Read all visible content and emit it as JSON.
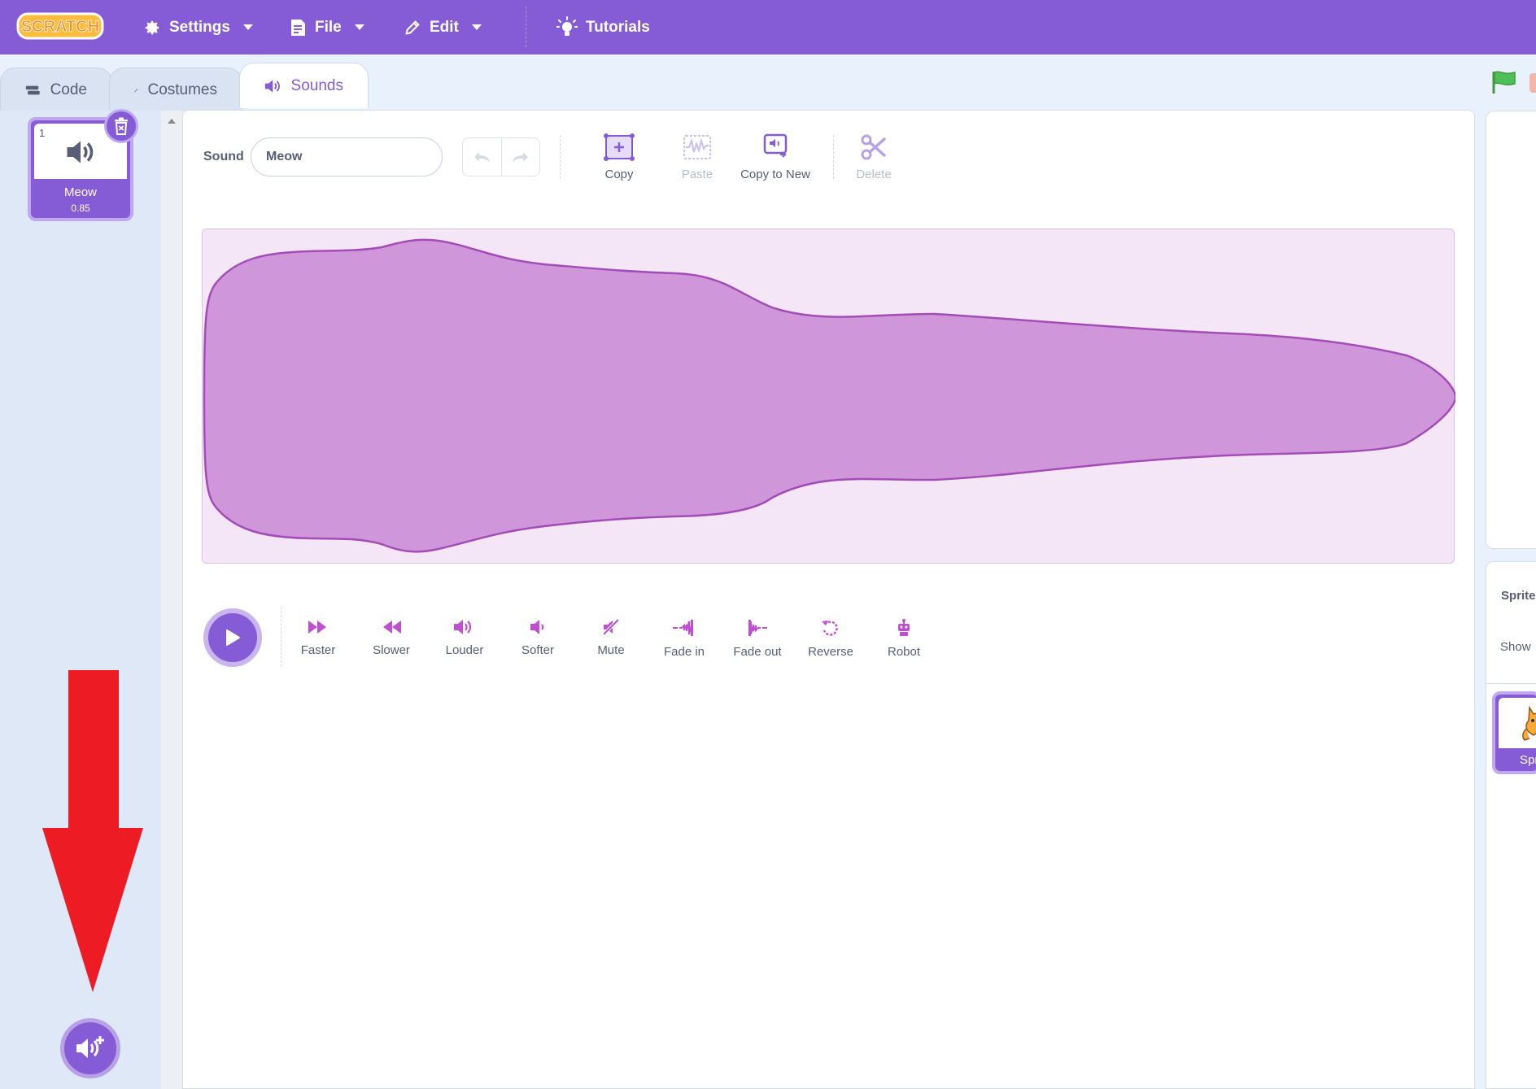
{
  "menubar": {
    "logo_text": "SCRATCH",
    "settings_label": "Settings",
    "file_label": "File",
    "edit_label": "Edit",
    "tutorials_label": "Tutorials"
  },
  "tabs": [
    {
      "label": "Code",
      "icon": "code-blocks-icon"
    },
    {
      "label": "Costumes",
      "icon": "brush-icon"
    },
    {
      "label": "Sounds",
      "icon": "speaker-icon",
      "active": true
    }
  ],
  "sound_list": {
    "items": [
      {
        "index": "1",
        "name": "Meow",
        "duration": "0.85",
        "icon": "speaker-icon"
      }
    ],
    "add_button_icon": "add-sound-icon"
  },
  "editor": {
    "sound_label": "Sound",
    "sound_name_value": "Meow",
    "tools": {
      "copy": "Copy",
      "paste": "Paste",
      "copy_to_new": "Copy to New",
      "delete": "Delete"
    },
    "effects": [
      {
        "label": "Faster",
        "icon": "faster-icon"
      },
      {
        "label": "Slower",
        "icon": "slower-icon"
      },
      {
        "label": "Louder",
        "icon": "louder-icon"
      },
      {
        "label": "Softer",
        "icon": "softer-icon"
      },
      {
        "label": "Mute",
        "icon": "mute-icon"
      },
      {
        "label": "Fade in",
        "icon": "fade-in-icon"
      },
      {
        "label": "Fade out",
        "icon": "fade-out-icon"
      },
      {
        "label": "Reverse",
        "icon": "reverse-icon"
      },
      {
        "label": "Robot",
        "icon": "robot-icon"
      }
    ]
  },
  "right_pane": {
    "sprite_label": "Sprite",
    "show_label": "Show",
    "sprite_thumb_label": "Spr"
  },
  "colors": {
    "brand_purple": "#855cd6",
    "waveform_fill": "#cf96da",
    "waveform_stroke": "#a34cb8",
    "annotation_arrow": "#ed1c24"
  }
}
